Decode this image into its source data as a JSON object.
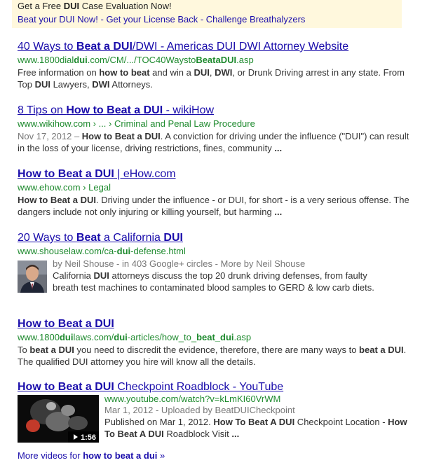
{
  "ad": {
    "line1_pre": "Get a Free ",
    "line1_bold": "DUI",
    "line1_post": " Case Evaluation Now!",
    "links": [
      "Beat your DUI Now!",
      "Get your License Back",
      "Challenge Breathalyzers"
    ],
    "separator": " - "
  },
  "results": [
    {
      "title_parts": [
        {
          "t": "40 Ways to ",
          "b": false
        },
        {
          "t": "Beat a DUI",
          "b": true
        },
        {
          "t": "/DWI - Americas DUI DWI Attorney Website",
          "b": false
        }
      ],
      "url_parts": [
        {
          "t": "www.1800dial",
          "b": false
        },
        {
          "t": "dui",
          "b": true
        },
        {
          "t": ".com/CM/.../TOC40Waysto",
          "b": false
        },
        {
          "t": "BeataDUI",
          "b": true
        },
        {
          "t": ".asp",
          "b": false
        }
      ],
      "snippet_parts": [
        {
          "t": "Free information on ",
          "b": false
        },
        {
          "t": "how to beat",
          "b": true
        },
        {
          "t": " and win a ",
          "b": false
        },
        {
          "t": "DUI",
          "b": true
        },
        {
          "t": ", ",
          "b": false
        },
        {
          "t": "DWI",
          "b": true
        },
        {
          "t": ", or Drunk Driving arrest in any state. From Top ",
          "b": false
        },
        {
          "t": "DUI",
          "b": true
        },
        {
          "t": " Lawyers, ",
          "b": false
        },
        {
          "t": "DWI",
          "b": true
        },
        {
          "t": " Attorneys.",
          "b": false
        }
      ]
    },
    {
      "title_parts": [
        {
          "t": "8 Tips on ",
          "b": false
        },
        {
          "t": "How to Beat a DUI",
          "b": true
        },
        {
          "t": " - wikiHow",
          "b": false
        }
      ],
      "url_parts": [
        {
          "t": "www.wikihow.com › ... › Criminal and Penal Law Procedure",
          "b": false
        }
      ],
      "snippet_parts": [
        {
          "t": "Nov 17, 2012 – ",
          "b": false,
          "m": true
        },
        {
          "t": "How to Beat a DUI",
          "b": true
        },
        {
          "t": ". A conviction for driving under the influence (\"DUI\") can result in the loss of your license, driving restrictions, fines, community ",
          "b": false
        },
        {
          "t": "...",
          "b": true
        }
      ]
    },
    {
      "title_parts": [
        {
          "t": "How to Beat a DUI",
          "b": true
        },
        {
          "t": " | eHow.com",
          "b": false
        }
      ],
      "url_parts": [
        {
          "t": "www.ehow.com › Legal",
          "b": false
        }
      ],
      "snippet_parts": [
        {
          "t": "How to Beat a DUI",
          "b": true
        },
        {
          "t": ". Driving under the influence - or DUI, for short - is a very serious offense. The dangers include not only injuring or killing yourself, but harming ",
          "b": false
        },
        {
          "t": "...",
          "b": true
        }
      ]
    },
    {
      "title_parts": [
        {
          "t": "20 Ways to ",
          "b": false
        },
        {
          "t": "Beat",
          "b": true
        },
        {
          "t": " a California ",
          "b": false
        },
        {
          "t": "DUI",
          "b": true
        }
      ],
      "url_parts": [
        {
          "t": "www.shouselaw.com/ca-",
          "b": false
        },
        {
          "t": "dui",
          "b": true
        },
        {
          "t": "-defense.html",
          "b": false
        }
      ],
      "author_line": "by Neil Shouse - in 403 Google+ circles - More by Neil Shouse",
      "snippet_parts": [
        {
          "t": "California ",
          "b": false
        },
        {
          "t": "DUI",
          "b": true
        },
        {
          "t": " attorneys discuss the top 20 drunk driving defenses, from faulty breath test machines to contaminated blood samples to GERD & low carb diets.",
          "b": false
        }
      ]
    },
    {
      "title_parts": [
        {
          "t": "How to Beat a DUI",
          "b": true
        }
      ],
      "url_parts": [
        {
          "t": "www.1800",
          "b": false
        },
        {
          "t": "dui",
          "b": true
        },
        {
          "t": "laws.com/",
          "b": false
        },
        {
          "t": "dui",
          "b": true
        },
        {
          "t": "-articles/how_to_",
          "b": false
        },
        {
          "t": "beat_dui",
          "b": true
        },
        {
          "t": ".asp",
          "b": false
        }
      ],
      "snippet_parts": [
        {
          "t": "To ",
          "b": false
        },
        {
          "t": "beat a DUI",
          "b": true
        },
        {
          "t": " you need to discredit the evidence, therefore, there are many ways to ",
          "b": false
        },
        {
          "t": "beat a DUI",
          "b": true
        },
        {
          "t": ". The qualified DUI attorney you hire will know all the details.",
          "b": false
        }
      ]
    },
    {
      "title_parts": [
        {
          "t": "How to Beat a DUI",
          "b": true
        },
        {
          "t": " Checkpoint Roadblock - YouTube",
          "b": false
        }
      ],
      "url_parts": [
        {
          "t": "www.youtube.com/watch?v=kLmKI60VrWM",
          "b": false
        }
      ],
      "author_line": "Mar 1, 2012 - Uploaded by BeatDUICheckpoint",
      "snippet_parts": [
        {
          "t": "Published on Mar 1, 2012. ",
          "b": false
        },
        {
          "t": "How To Beat A DUI",
          "b": true
        },
        {
          "t": " Checkpoint Location - ",
          "b": false
        },
        {
          "t": "How To Beat A DUI",
          "b": true
        },
        {
          "t": " Roadblock Visit ",
          "b": false
        },
        {
          "t": "...",
          "b": true
        }
      ],
      "duration": "1:56"
    }
  ],
  "more_videos": {
    "prefix": "More videos for ",
    "query": "how to beat a dui",
    "suffix": " »"
  },
  "colors": {
    "link": "#1a0dab",
    "url": "#1e8a2e",
    "ad_bg": "#fff8dd"
  },
  "icons": {
    "author_photo": "author-photo",
    "video_thumbnail": "video-thumbnail",
    "play": "play-icon"
  }
}
